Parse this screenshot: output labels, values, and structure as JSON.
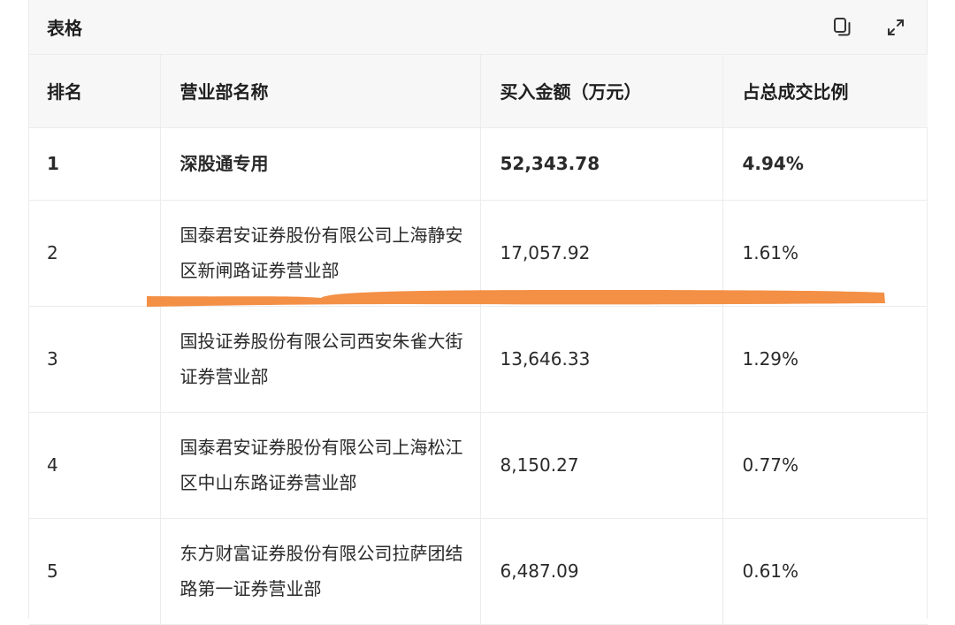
{
  "card": {
    "title": "表格",
    "copy_icon": "copy-icon",
    "expand_icon": "expand-icon"
  },
  "table": {
    "headers": [
      "排名",
      "营业部名称",
      "买入金额（万元）",
      "占总成交比例"
    ],
    "rows": [
      {
        "rank": "1",
        "name": "深股通专用",
        "amount": "52,343.78",
        "ratio": "4.94%"
      },
      {
        "rank": "2",
        "name": "国泰君安证券股份有限公司上海静安区新闸路证券营业部",
        "amount": "17,057.92",
        "ratio": "1.61%"
      },
      {
        "rank": "3",
        "name": "国投证券股份有限公司西安朱雀大街证券营业部",
        "amount": "13,646.33",
        "ratio": "1.29%"
      },
      {
        "rank": "4",
        "name": "国泰君安证券股份有限公司上海松江区中山东路证券营业部",
        "amount": "8,150.27",
        "ratio": "0.77%"
      },
      {
        "rank": "5",
        "name": "东方财富证券股份有限公司拉萨团结路第一证券营业部",
        "amount": "6,487.09",
        "ratio": "0.61%"
      }
    ]
  },
  "colors": {
    "highlight": "#f28a3c",
    "header_bg": "#f7f7f8",
    "border": "#ececec"
  }
}
